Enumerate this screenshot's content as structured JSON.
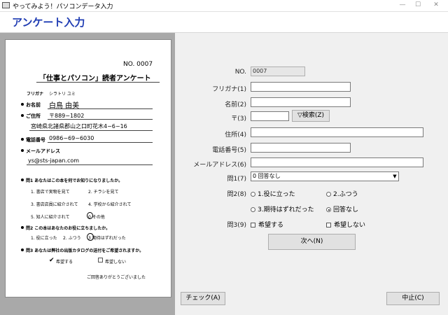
{
  "window": {
    "title": "やってみよう！パソコンデータ入力"
  },
  "header": {
    "title": "アンケート入力"
  },
  "paper": {
    "no": "NO. 0007",
    "heading": "「仕事とパソコン」読者アンケート",
    "furigana_label": "フリガナ",
    "furigana_value": "シラトリ ユミ",
    "name_label": "お名前",
    "name_value": "白鳥  由美",
    "address_label": "ご住所",
    "zip_value": "〒889−1802",
    "address_value": "宮崎県北諸県郡山之口町花木4−6−16",
    "phone_label": "電話番号",
    "phone_value": "0986−69−6030",
    "email_label": "メールアドレス",
    "email_value": "ys@sts-japan.com",
    "q1": "問1 あなたはこの本を何でお知りになりましたか。",
    "q1_options": [
      "1. 書店で実物を見て",
      "2. チラシを見て",
      "3. 書店店員に紹介されて",
      "4. 学校から紹介されて",
      "5. 知人に紹介されて",
      "0 その他"
    ],
    "q2": "問2 この本はあなたのお役に立ちましたか。",
    "q2_options": [
      "1. 役に立った",
      "2. ふつう",
      "3 期待はずれだった"
    ],
    "q3": "問3 あなたは弊社の出版カタログの送付をご希望されますか。",
    "q3_options": [
      "希望する",
      "希望しない"
    ],
    "thanks": "ご回答ありがとうございました"
  },
  "form": {
    "no_label": "NO.",
    "no_value": "0007",
    "furigana_label": "フリガナ(1)",
    "name_label": "名前(2)",
    "zip_label": "〒(3)",
    "search_button": "▽検索(Z)",
    "address_label": "住所(4)",
    "phone_label": "電話番号(5)",
    "email_label": "メールアドレス(6)",
    "q1_label": "問1(7)",
    "q1_value": "0 回答なし",
    "q2_label": "問2(8)",
    "q2_options": [
      "1.役に立った",
      "2.ふつう",
      "3.期待はずれだった",
      "回答なし"
    ],
    "q2_selected": "回答なし",
    "q3_label": "問3(9)",
    "q3_options": [
      "希望する",
      "希望しない"
    ],
    "next_button": "次へ(N)",
    "check_button": "チェック(A)",
    "cancel_button": "中止(C)"
  },
  "colors": {
    "header_title": "#1f3cb3",
    "left_bg": "#a9a9a9"
  }
}
